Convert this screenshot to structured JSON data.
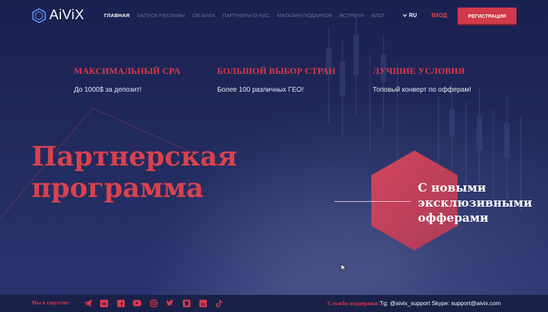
{
  "header": {
    "logo_text": "AiViX",
    "nav": [
      {
        "label": "ГЛАВНАЯ",
        "active": true
      },
      {
        "label": "ЗАПУСК РЕКЛАМЫ",
        "active": false
      },
      {
        "label": "ОБ AIVIX",
        "active": false
      },
      {
        "label": "ПАРТНЕРЫ О НАС",
        "active": false
      },
      {
        "label": "МАГАЗИН ПОДАРКОВ",
        "active": false
      },
      {
        "label": "ВСТРЕЧИ",
        "active": false
      },
      {
        "label": "БЛОГ",
        "active": false
      }
    ],
    "lang": "RU",
    "login": "ВХОД",
    "register": "РЕГИСТРАЦИЯ"
  },
  "features": [
    {
      "title": "МАКСИМАЛЬНЫЙ CPA",
      "text": "До 1000$ за депозит!"
    },
    {
      "title": "БОЛЬШОЙ ВЫБОР СТРАН",
      "text": "Более 100 различных ГЕО!"
    },
    {
      "title": "ЛУЧШИЕ УСЛОВИЯ",
      "text": "Топовый конверт по офферам!"
    }
  ],
  "hero": {
    "title_line1": "Партнерская",
    "title_line2": "программа",
    "tagline1": "С новыми",
    "tagline2": "эксклюзивными",
    "tagline3": "офферами"
  },
  "footer": {
    "social_label": "Мы в соцсетях:",
    "socials": [
      "telegram-icon",
      "vk-icon",
      "facebook-icon",
      "youtube-icon",
      "instagram-icon",
      "twitter-icon",
      "tenchat-icon",
      "linkedin-icon",
      "tiktok-icon"
    ],
    "support_label": "Служба поддержки:",
    "support_value": "Tg: @aivix_support Skype: support@aivix.com"
  },
  "colors": {
    "accent": "#d9394a",
    "background": "#1c2450"
  }
}
